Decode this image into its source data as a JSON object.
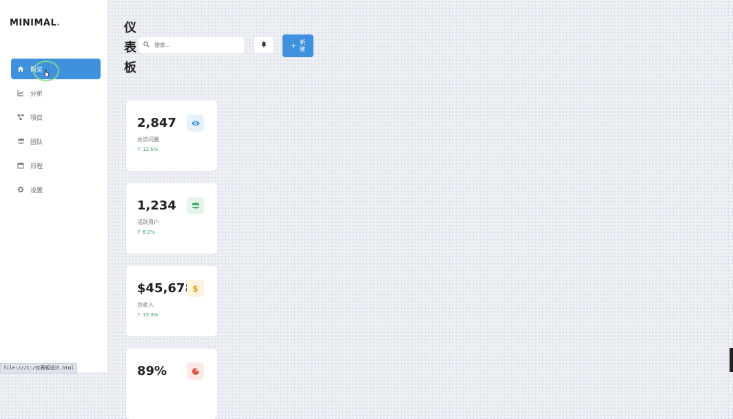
{
  "app": {
    "logo_text": "MINIMAL",
    "logo_dot": "."
  },
  "sidebar": {
    "items": [
      {
        "label": "概览",
        "icon": "home-icon",
        "active": true
      },
      {
        "label": "分析",
        "icon": "chart-line-icon",
        "active": false
      },
      {
        "label": "项目",
        "icon": "project-diagram-icon",
        "active": false
      },
      {
        "label": "团队",
        "icon": "users-icon",
        "active": false
      },
      {
        "label": "日程",
        "icon": "calendar-icon",
        "active": false
      },
      {
        "label": "设置",
        "icon": "gear-icon",
        "active": false
      }
    ]
  },
  "header": {
    "title": "仪表板",
    "search_placeholder": "搜索...",
    "new_button_label": "新建",
    "new_button_icon": "plus-icon",
    "notification_icon": "bell-icon"
  },
  "stats": [
    {
      "value": "2,847",
      "label": "总访问量",
      "trend": "12.5%",
      "icon": "eye-icon",
      "icon_color": "#3b8fd9",
      "icon_bg": "#e6f1fb"
    },
    {
      "value": "1,234",
      "label": "活跃用户",
      "trend": "8.2%",
      "icon": "users-icon",
      "icon_color": "#2f9e5a",
      "icon_bg": "#e5f5ea"
    },
    {
      "value": "$45,678",
      "label": "总收入",
      "trend": "15.3%",
      "icon": "dollar-icon",
      "icon_color": "#e8a317",
      "icon_bg": "#fdf3df"
    },
    {
      "value": "89%",
      "label": "",
      "trend": "",
      "icon": "pie-chart-icon",
      "icon_color": "#e0533f",
      "icon_bg": "#fce8e5"
    }
  ],
  "status_bar": {
    "url": "file:///C:/仪表板设计.html"
  },
  "colors": {
    "accent": "#3f91de",
    "positive": "#2f9e5a"
  }
}
